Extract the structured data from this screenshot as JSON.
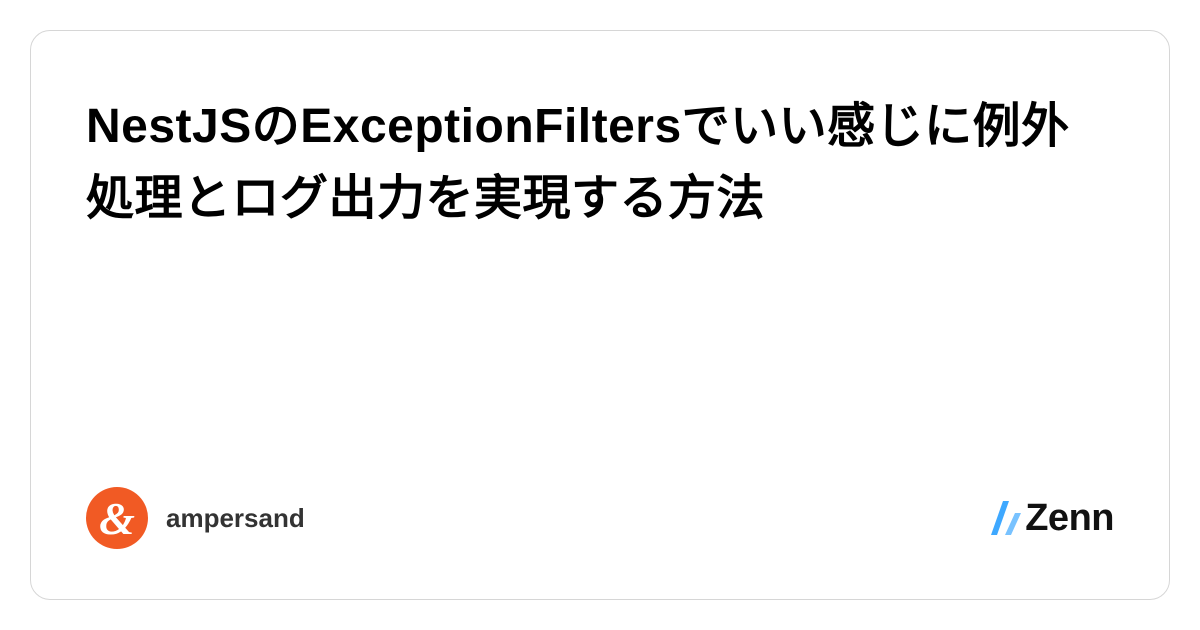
{
  "article": {
    "title": "NestJSのExceptionFiltersでいい感じに例外処理とログ出力を実現する方法"
  },
  "author": {
    "username": "ampersand",
    "avatar_symbol": "&",
    "avatar_bg": "#f15a24"
  },
  "platform": {
    "name": "Zenn"
  }
}
